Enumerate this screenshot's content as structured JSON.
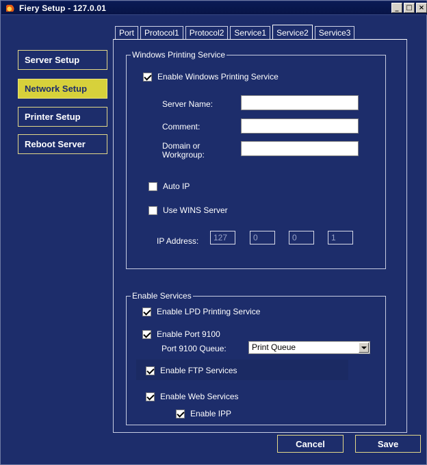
{
  "window": {
    "title": "Fiery Setup - 127.0.01",
    "controls": {
      "minimize": "_",
      "maximize": "□",
      "close": "×"
    }
  },
  "nav": {
    "items": [
      {
        "label": "Server Setup",
        "active": false
      },
      {
        "label": "Network Setup",
        "active": true
      },
      {
        "label": "Printer Setup",
        "active": false
      },
      {
        "label": "Reboot Server",
        "active": false
      }
    ]
  },
  "tabs": [
    "Port",
    "Protocol1",
    "Protocol2",
    "Service1",
    "Service2",
    "Service3"
  ],
  "active_tab": "Service2",
  "windows_printing": {
    "group_title": "Windows Printing Service",
    "enable_label": "Enable Windows Printing Service",
    "enable_checked": true,
    "server_name_label": "Server Name:",
    "server_name_value": "",
    "comment_label": "Comment:",
    "comment_value": "",
    "domain_label_1": "Domain or",
    "domain_label_2": "Workgroup:",
    "domain_value": "",
    "auto_ip_label": "Auto IP",
    "auto_ip_checked": false,
    "wins_label": "Use WINS Server",
    "wins_checked": false,
    "ip_label": "IP Address:",
    "ip_octets": [
      "127",
      "0",
      "0",
      "1"
    ]
  },
  "enable_services": {
    "group_title": "Enable Services",
    "lpd_label": "Enable LPD Printing Service",
    "lpd_checked": true,
    "port9100_label": "Enable Port 9100",
    "port9100_checked": true,
    "queue_label": "Port 9100 Queue:",
    "queue_value": "Print Queue",
    "ftp_label": "Enable FTP Services",
    "ftp_checked": true,
    "web_label": "Enable Web Services",
    "web_checked": true,
    "ipp_label": "Enable IPP",
    "ipp_checked": true
  },
  "actions": {
    "cancel": "Cancel",
    "save": "Save"
  },
  "colors": {
    "background": "#1d2d6b",
    "accent": "#d7d13b",
    "border_yellow": "#e4d989"
  }
}
